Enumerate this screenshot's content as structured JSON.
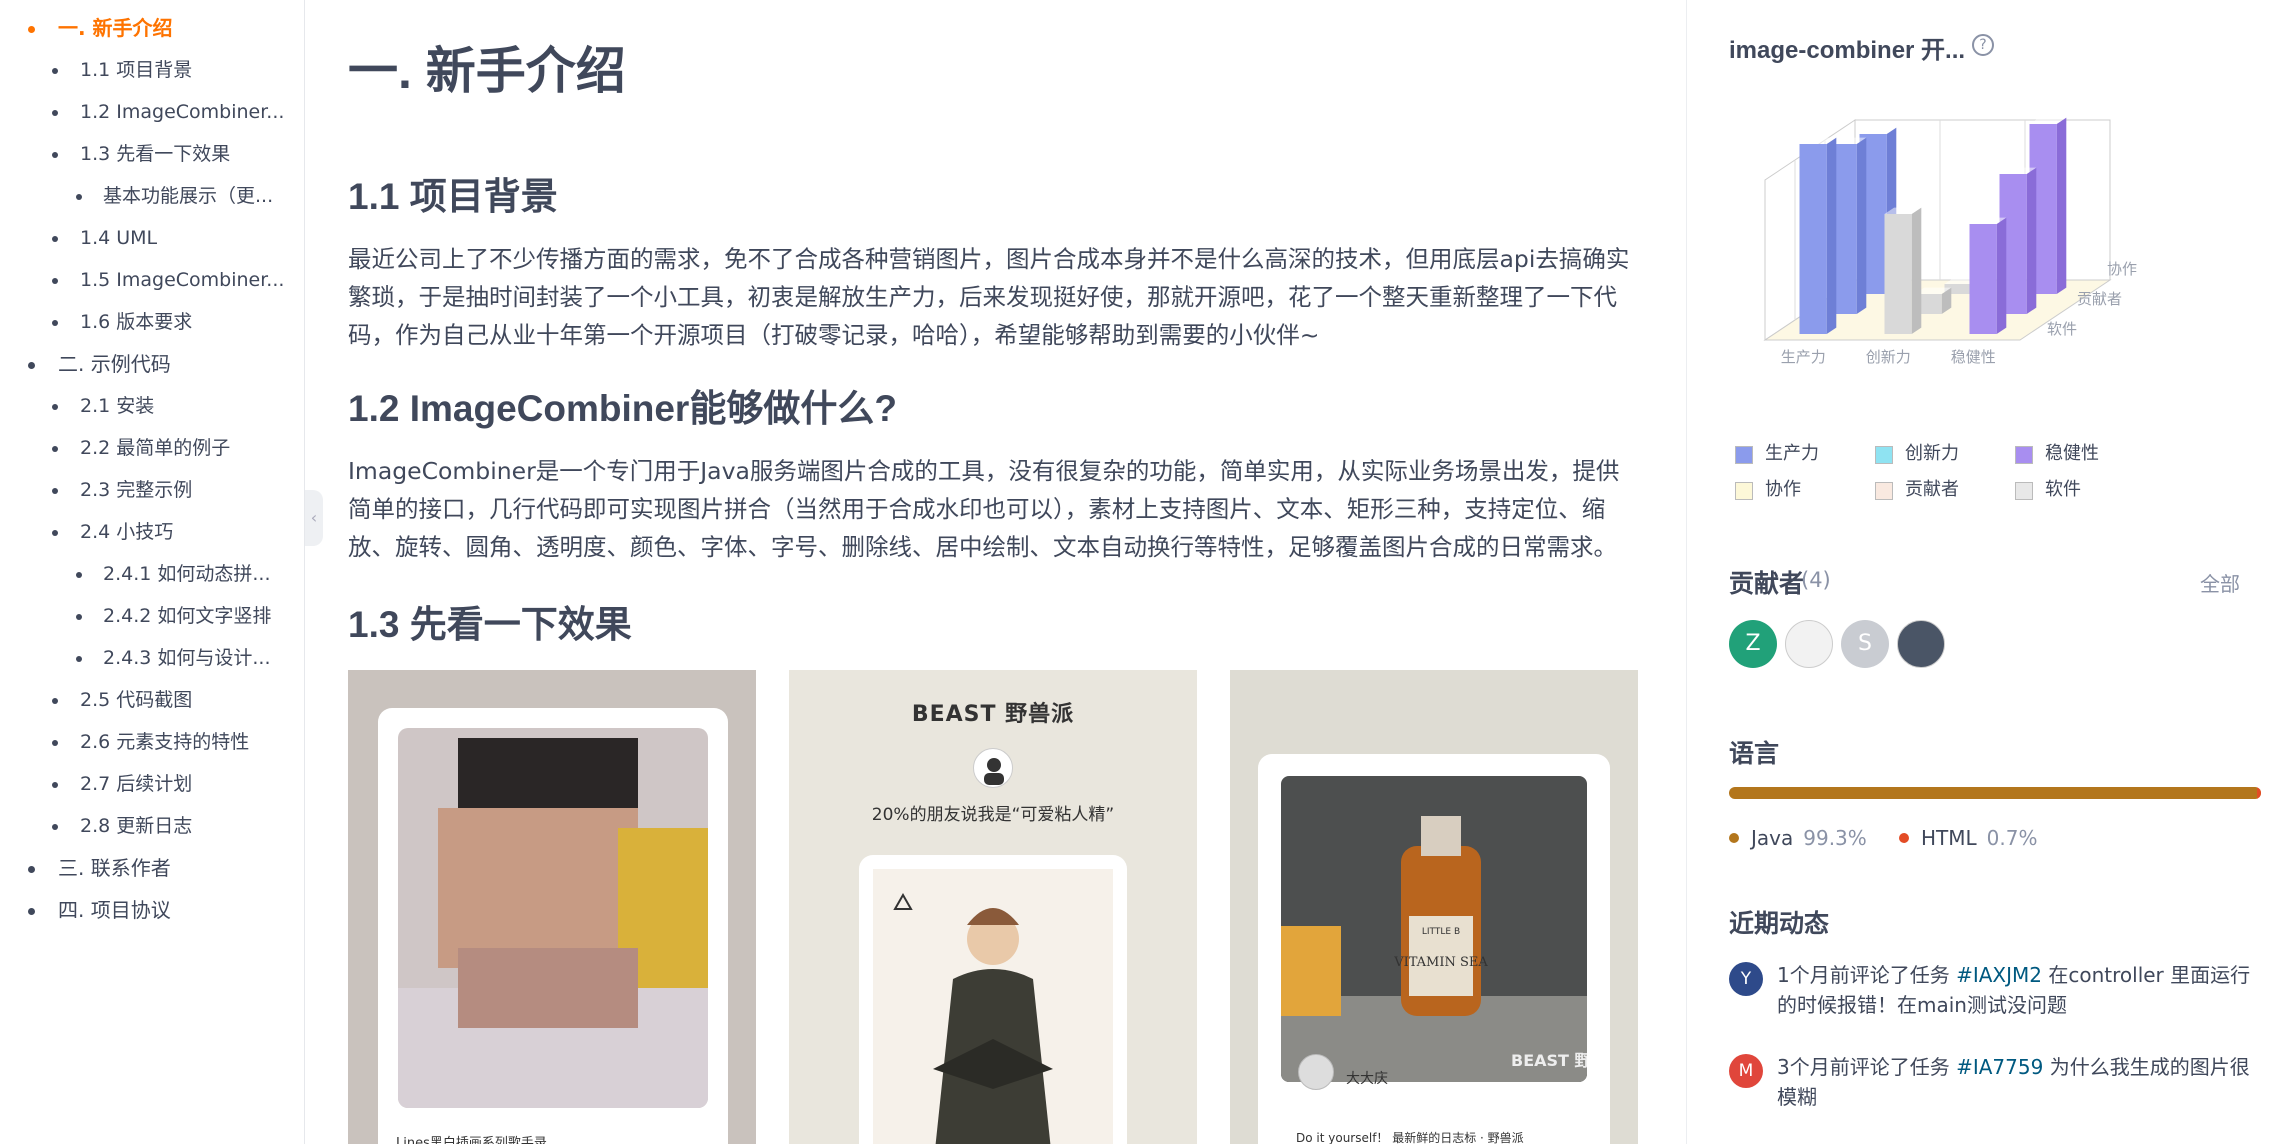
{
  "toc": {
    "items": [
      {
        "label": "一. 新手介绍",
        "level": 1,
        "active": true
      },
      {
        "label": "1.1 项目背景",
        "level": 2
      },
      {
        "label": "1.2 ImageCombiner...",
        "level": 2
      },
      {
        "label": "1.3 先看一下效果",
        "level": 2
      },
      {
        "label": "基本功能展示（更...",
        "level": 3
      },
      {
        "label": "1.4 UML",
        "level": 2
      },
      {
        "label": "1.5 ImageCombiner...",
        "level": 2
      },
      {
        "label": "1.6 版本要求",
        "level": 2
      },
      {
        "label": "二. 示例代码",
        "level": 1
      },
      {
        "label": "2.1 安装",
        "level": 2
      },
      {
        "label": "2.2 最简单的例子",
        "level": 2
      },
      {
        "label": "2.3 完整示例",
        "level": 2
      },
      {
        "label": "2.4 小技巧",
        "level": 2
      },
      {
        "label": "2.4.1 如何动态拼...",
        "level": 3
      },
      {
        "label": "2.4.2 如何文字竖排",
        "level": 3
      },
      {
        "label": "2.4.3 如何与设计...",
        "level": 3
      },
      {
        "label": "2.5 代码截图",
        "level": 2
      },
      {
        "label": "2.6 元素支持的特性",
        "level": 2
      },
      {
        "label": "2.7 后续计划",
        "level": 2
      },
      {
        "label": "2.8 更新日志",
        "level": 2
      },
      {
        "label": "三. 联系作者",
        "level": 1
      },
      {
        "label": "四. 项目协议",
        "level": 1
      }
    ],
    "collapse_glyph": "‹"
  },
  "article": {
    "h1": "一. 新手介绍",
    "bg_title": "1.1 项目背景",
    "bg_text": "最近公司上了不少传播方面的需求，免不了合成各种营销图片，图片合成本身并不是什么高深的技术，但用底层api去搞确实繁琐，于是抽时间封装了一个小工具，初衷是解放生产力，后来发现挺好使，那就开源吧，花了一个整天重新整理了一下代码，作为自己从业十年第一个开源项目（打破零记录，哈哈），希望能够帮助到需要的小伙伴~",
    "do_title": "1.2 ImageCombiner能够做什么?",
    "do_text": "ImageCombiner是一个专门用于Java服务端图片合成的工具，没有很复杂的功能，简单实用，从实际业务场景出发，提供简单的接口，几行代码即可实现图片拼合（当然用于合成水印也可以），素材上支持图片、文本、矩形三种，支持定位、缩放、旋转、圆角、透明度、颜色、字体、字号、删除线、居中绘制、文本自动换行等特性，足够覆盖图片合成的日常需求。",
    "effect_title": "1.3 先看一下效果",
    "gallery": {
      "shot1_caption": "Lines黑白插画系列歌手录",
      "shot2_brand": "BEAST 野兽派",
      "shot2_quote": "20%的朋友说我是“可爱粘人精”",
      "shot3_bottle_top": "LITTLE B",
      "shot3_bottle_name": "VITAMIN SEA",
      "shot3_brand": "BEAST 野兽派",
      "shot3_user": "大大庆",
      "shot3_caption": "Do it yourself！ 最新鲜的日志标 · 野兽派"
    }
  },
  "sidebar": {
    "radar_title": "image-combiner 开...",
    "help_glyph": "?",
    "chart_legend": [
      {
        "label": "生产力",
        "color": "#8b9bec"
      },
      {
        "label": "创新力",
        "color": "#8fe3f2"
      },
      {
        "label": "稳健性",
        "color": "#a88ef0"
      },
      {
        "label": "协作",
        "color": "#fdf8d8"
      },
      {
        "label": "贡献者",
        "color": "#f9e9e0"
      },
      {
        "label": "软件",
        "color": "#e8e8e8"
      }
    ],
    "contributors_title": "贡献者",
    "contributors_count": "(4)",
    "contributors_all": "全部",
    "contributors": [
      {
        "initial": "Z",
        "color": "#21a179"
      },
      {
        "initial": "",
        "color": "#f2f2f2"
      },
      {
        "initial": "S",
        "color": "#c9ccd2"
      },
      {
        "initial": "",
        "color": "#4a5566"
      }
    ],
    "language_title": "语言",
    "languages": [
      {
        "name": "Java",
        "pct": "99.3%",
        "color": "#b3761c"
      },
      {
        "name": "HTML",
        "pct": "0.7%",
        "color": "#e34c26"
      }
    ],
    "activity_title": "近期动态",
    "activities": [
      {
        "avatar": "Y",
        "avatar_color": "#2e4a8a",
        "prefix": "1个月前评论了任务 ",
        "link": "#IAXJM2",
        "suffix": " 在controller 里面运行的时候报错！在main测试没问题"
      },
      {
        "avatar": "M",
        "avatar_color": "#e0463b",
        "prefix": "3个月前评论了任务 ",
        "link": "#IA7759",
        "suffix": " 为什么我生成的图片很模糊"
      }
    ]
  },
  "chart_data": {
    "type": "bar",
    "title": "",
    "x_axis": [
      "生产力",
      "创新力",
      "稳健性"
    ],
    "y_axis": [
      "协作",
      "贡献者",
      "软件"
    ],
    "series": [
      {
        "name": "生产力",
        "values": [
          95,
          85,
          80
        ]
      },
      {
        "name": "创新力",
        "values": [
          60,
          10,
          5
        ]
      },
      {
        "name": "稳健性",
        "values": [
          55,
          70,
          85
        ]
      }
    ],
    "grid": true
  }
}
